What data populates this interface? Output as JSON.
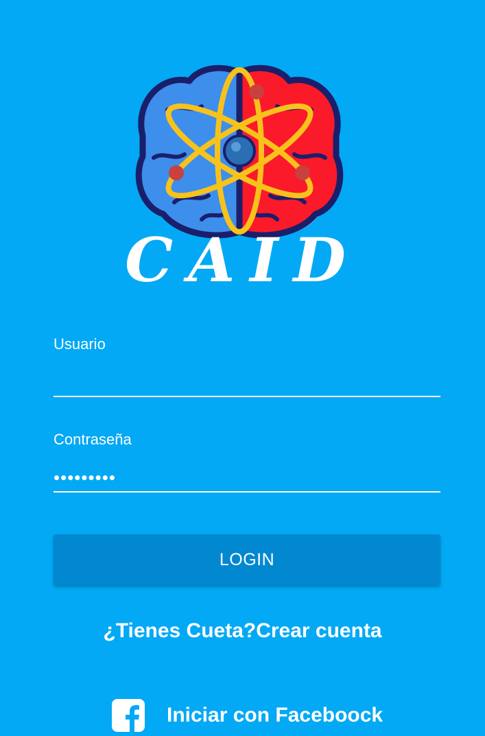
{
  "logo": {
    "wordmark": "CAID",
    "icon": "brain-atom-logo-icon",
    "colors": {
      "brain_left": "#3E8EEB",
      "brain_right": "#FB1A2A",
      "brain_outline": "#1A1F6B",
      "orbit": "#F7C21C",
      "nucleus": "#2A6FB3",
      "electron": "#C9403F",
      "lilac": "#B59CF0"
    }
  },
  "form": {
    "username_label": "Usuario",
    "username_value": "",
    "password_label": "Contraseña",
    "password_value": "•••••••••"
  },
  "login_label": "LOGIN",
  "signup_text": "¿Tienes Cueta?Crear cuenta",
  "facebook": {
    "label": "Iniciar con Faceboock",
    "icon": "facebook-icon"
  },
  "colors": {
    "background": "#03A9F4",
    "button": "#0288D1",
    "text": "#FFFFFF"
  }
}
